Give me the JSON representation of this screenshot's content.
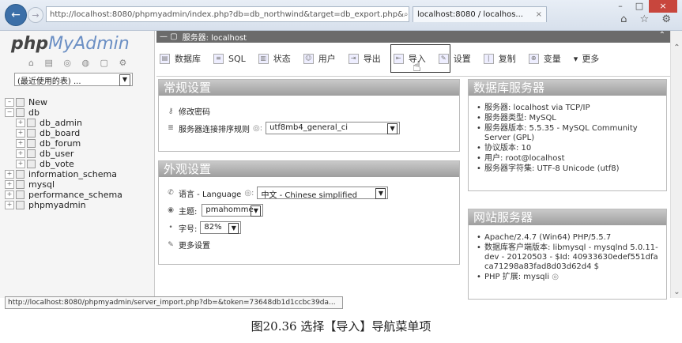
{
  "browser": {
    "url": "http://localhost:8080/phpmyadmin/index.php?db=db_northwind&target=db_export.php&",
    "url_host": "localhost",
    "tab_title": "localhost:8080 / localhos...",
    "window_controls": [
      "–",
      "□",
      "×"
    ]
  },
  "sidebar": {
    "logo_php": "php",
    "logo_my": "My",
    "logo_admin": "Admin",
    "recent_select": "(最近使用的表) ...",
    "tree": [
      {
        "label": "New",
        "level": 0
      },
      {
        "label": "db",
        "level": 0
      },
      {
        "label": "db_admin",
        "level": 1
      },
      {
        "label": "db_board",
        "level": 1
      },
      {
        "label": "db_forum",
        "level": 1
      },
      {
        "label": "db_user",
        "level": 1
      },
      {
        "label": "db_vote",
        "level": 1
      },
      {
        "label": "information_schema",
        "level": 0
      },
      {
        "label": "mysql",
        "level": 0
      },
      {
        "label": "performance_schema",
        "level": 0
      },
      {
        "label": "phpmyadmin",
        "level": 0
      }
    ]
  },
  "breadcrumb": "服务器: localhost",
  "menu": [
    {
      "label": "数据库",
      "icon": "database-icon"
    },
    {
      "label": "SQL",
      "icon": "sql-icon"
    },
    {
      "label": "状态",
      "icon": "status-icon"
    },
    {
      "label": "用户",
      "icon": "users-icon"
    },
    {
      "label": "导出",
      "icon": "export-icon"
    },
    {
      "label": "导入",
      "icon": "import-icon"
    },
    {
      "label": "设置",
      "icon": "settings-icon"
    },
    {
      "label": "复制",
      "icon": "replication-icon"
    },
    {
      "label": "变量",
      "icon": "variables-icon"
    },
    {
      "label": "更多",
      "icon": "more-icon"
    }
  ],
  "general_settings": {
    "title": "常规设置",
    "change_password": "修改密码",
    "collation_label": "服务器连接排序规则",
    "collation_value": "utf8mb4_general_ci"
  },
  "appearance_settings": {
    "title": "外观设置",
    "language_label": "语言 - Language",
    "language_value": "中文 - Chinese simplified",
    "theme_label": "主题:",
    "theme_value": "pmahomme",
    "fontsize_label": "字号:",
    "fontsize_value": "82%",
    "more_settings": "更多设置"
  },
  "db_server": {
    "title": "数据库服务器",
    "items": [
      "服务器: localhost via TCP/IP",
      "服务器类型: MySQL",
      "服务器版本: 5.5.35 - MySQL Community Server (GPL)",
      "协议版本: 10",
      "用户: root@localhost",
      "服务器字符集: UTF-8 Unicode (utf8)"
    ]
  },
  "web_server": {
    "title": "网站服务器",
    "items": [
      "Apache/2.4.7 (Win64) PHP/5.5.7",
      "数据库客户端版本: libmysql - mysqlnd 5.0.11-dev - 20120503 - $Id: 40933630edef551dfaca71298a83fad8d03d62d4 $",
      "PHP 扩展: mysqli"
    ]
  },
  "status_bar": "http://localhost:8080/phpmyadmin/server_import.php?db=&token=73648db1d1ccbc39da...",
  "caption": "图20.36   选择【导入】导航菜单项"
}
